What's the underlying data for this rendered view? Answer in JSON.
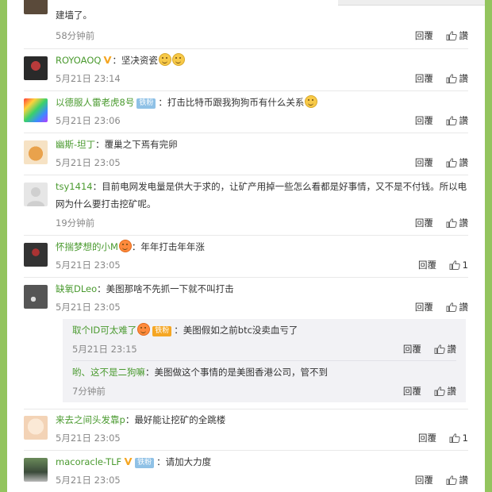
{
  "colors": {
    "background": "#93c45e",
    "username": "#4a9a2f",
    "badge": "#8fc1e6",
    "time": "#888888"
  },
  "comments": [
    {
      "content": "建墙了。",
      "time": "58分钟前",
      "reply": "回覆",
      "likes": "讚"
    },
    {
      "username": "ROYOAOQ",
      "colon": "：",
      "content": "坚决资瓷",
      "time": "5月21日 23:14",
      "reply": "回覆",
      "likes": "讚"
    },
    {
      "username": "以德服人雷老虎8号",
      "badge": "铁粉",
      "colon": "：",
      "content": "打击比特币跟我狗狗币有什么关系",
      "time": "5月21日 23:06",
      "reply": "回覆",
      "likes": "讚"
    },
    {
      "username": "幽斯-坦丁",
      "colon": "：",
      "content": "覆巢之下焉有完卵",
      "time": "5月21日 23:05",
      "reply": "回覆",
      "likes": "讚"
    },
    {
      "username": "tsy1414",
      "colon": "：",
      "content": "目前电网发电量是供大于求的，让矿产用掉一些怎么看都是好事情，又不是不付钱。所以电网为什么要打击挖矿呢。",
      "time": "19分钟前",
      "reply": "回覆",
      "likes": "讚"
    },
    {
      "username": "怀揣梦想的小M",
      "colon": "：",
      "content": "年年打击年年涨",
      "time": "5月21日 23:05",
      "reply": "回覆",
      "likes": "1"
    },
    {
      "username": "缺氧DLeo",
      "colon": "：",
      "content": "美图那啥不先抓一下就不叫打击",
      "time": "5月21日 23:05",
      "reply": "回覆",
      "likes": "讚"
    },
    {
      "username": "来去之间头发靠p",
      "colon": "：",
      "content": "最好能让挖矿的全跳楼",
      "time": "5月21日 23:05",
      "reply": "回覆",
      "likes": "1"
    },
    {
      "username": "macoracle-TLF",
      "badge": "铁粉",
      "colon": "：",
      "content": "请加大力度",
      "time": "5月21日 23:05",
      "reply": "回覆",
      "likes": "讚"
    }
  ],
  "replies": [
    {
      "username": "取个ID可太难了",
      "badge": "铁粉",
      "colon": "：",
      "content": "美图假如之前btc没卖血亏了",
      "time": "5月21日 23:15",
      "reply": "回覆",
      "likes": "讚"
    },
    {
      "username": "哟、这不是二狗嘛",
      "colon": "：",
      "content": "美图做这个事情的是美图香港公司，管不到",
      "time": "7分钟前",
      "reply": "回覆",
      "likes": "讚"
    }
  ]
}
